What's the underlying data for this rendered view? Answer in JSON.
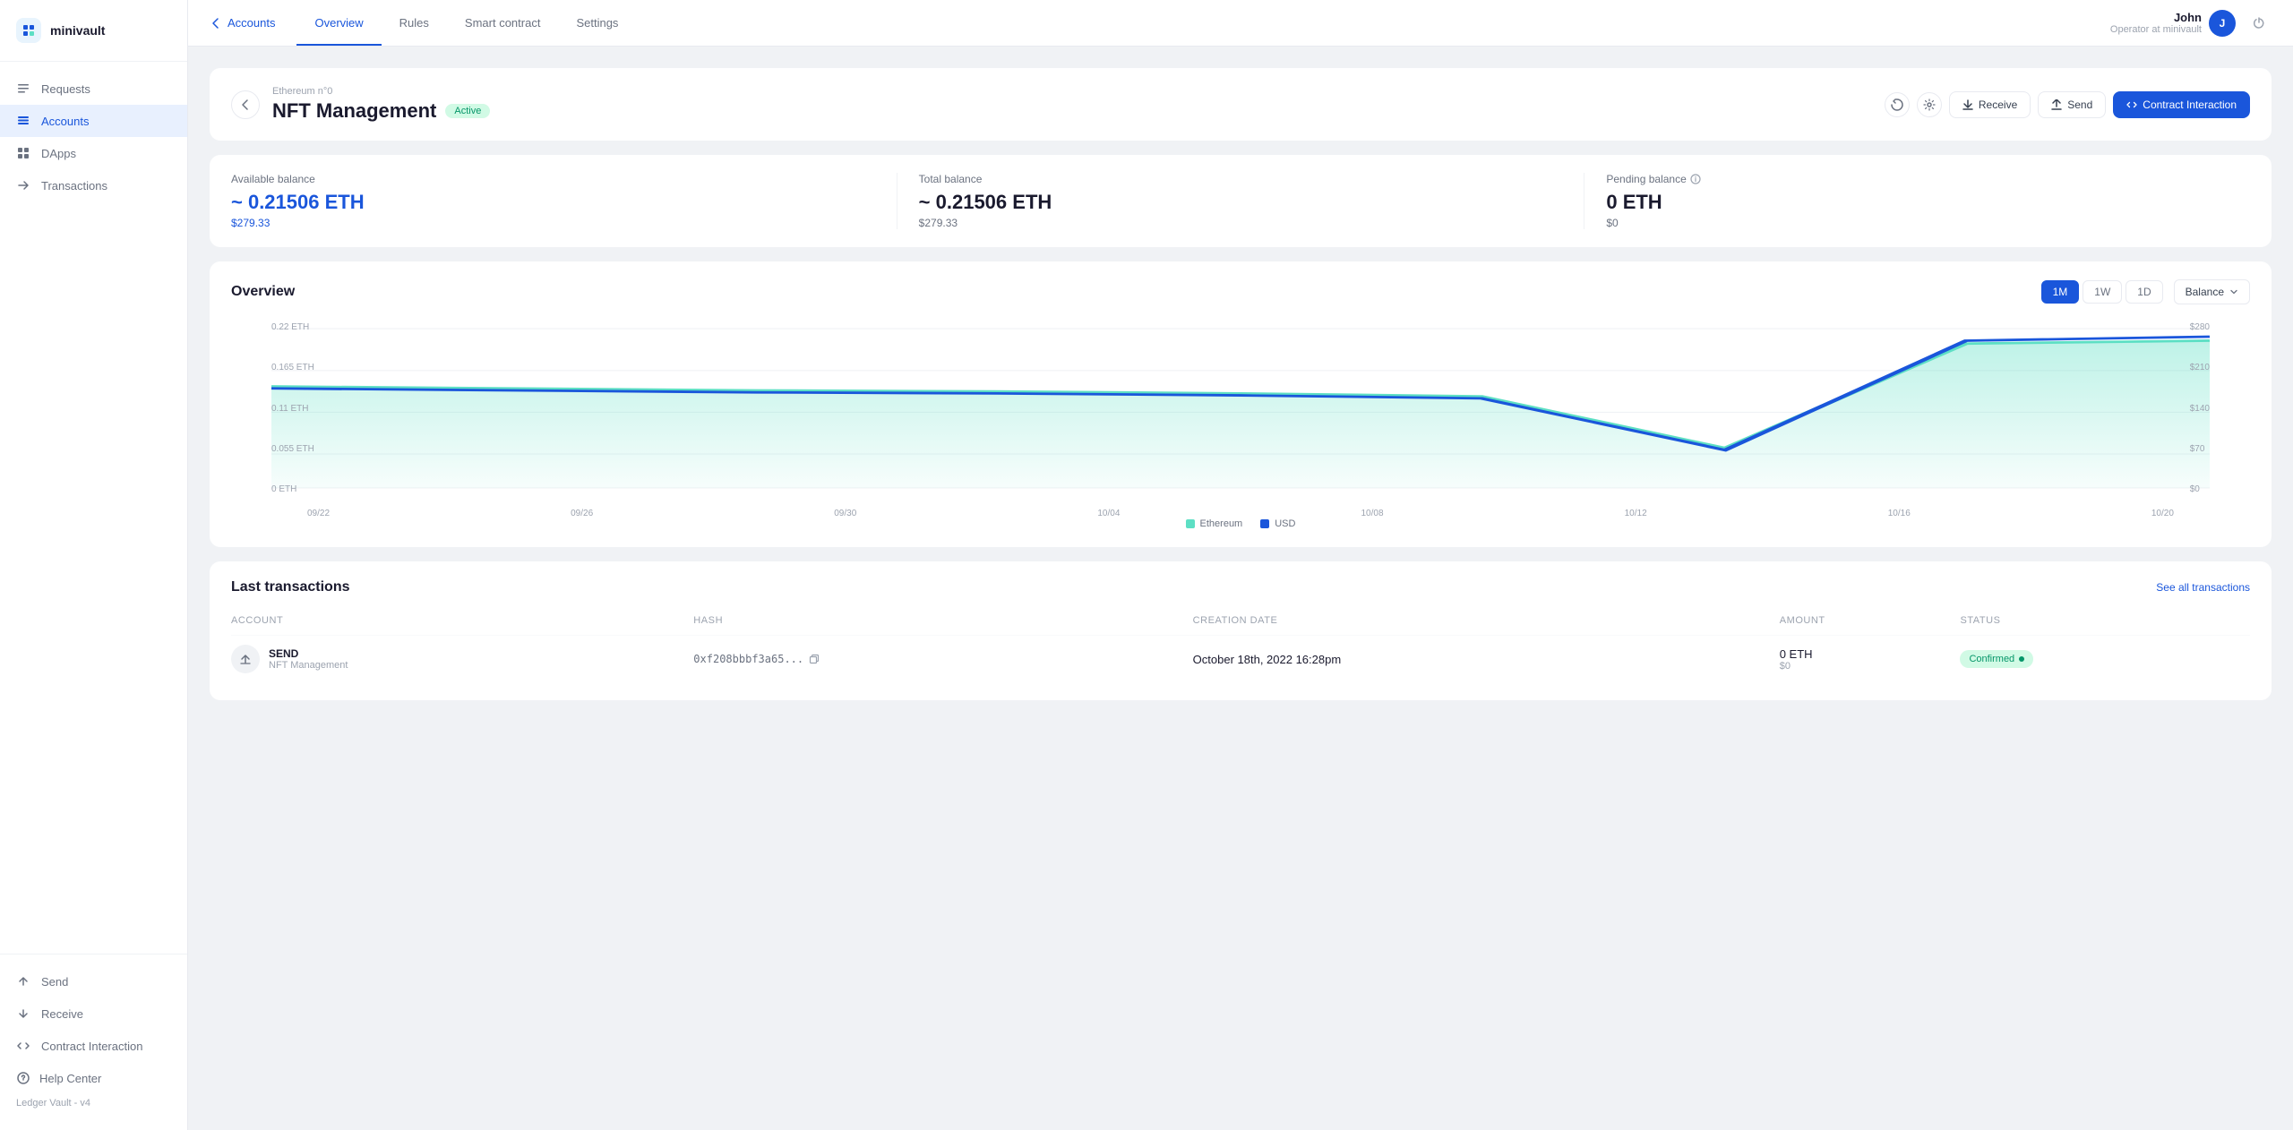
{
  "app": {
    "name": "minivault"
  },
  "sidebar": {
    "items": [
      {
        "id": "requests",
        "label": "Requests",
        "icon": "list"
      },
      {
        "id": "accounts",
        "label": "Accounts",
        "icon": "layers",
        "active": true
      },
      {
        "id": "dapps",
        "label": "DApps",
        "icon": "grid"
      },
      {
        "id": "transactions",
        "label": "Transactions",
        "icon": "arrow-right"
      }
    ],
    "bottom_items": [
      {
        "id": "send",
        "label": "Send",
        "icon": "arrow-up"
      },
      {
        "id": "receive",
        "label": "Receive",
        "icon": "arrow-down"
      },
      {
        "id": "contract",
        "label": "Contract Interaction",
        "icon": "code"
      }
    ],
    "help": "Help Center",
    "version": "Ledger Vault - v4"
  },
  "topnav": {
    "back_label": "Accounts",
    "tabs": [
      "Overview",
      "Rules",
      "Smart contract",
      "Settings"
    ],
    "active_tab": "Overview",
    "user": {
      "name": "John",
      "role": "Operator at minivault",
      "initial": "J"
    }
  },
  "account": {
    "sub_label": "Ethereum n°0",
    "name": "NFT Management",
    "status": "Active",
    "actions": {
      "refresh": "refresh",
      "settings": "settings",
      "receive": "Receive",
      "send": "Send",
      "contract": "Contract Interaction"
    }
  },
  "balances": {
    "available": {
      "label": "Available balance",
      "amount": "~ 0.21506 ETH",
      "usd": "$279.33"
    },
    "total": {
      "label": "Total balance",
      "amount": "~ 0.21506 ETH",
      "usd": "$279.33"
    },
    "pending": {
      "label": "Pending balance",
      "amount": "0 ETH",
      "usd": "$0",
      "info_icon": true
    }
  },
  "overview": {
    "title": "Overview",
    "periods": [
      "1M",
      "1W",
      "1D"
    ],
    "active_period": "1M",
    "view_select": "Balance",
    "chart": {
      "y_labels_left": [
        "0.22 ETH",
        "0.165 ETH",
        "0.11 ETH",
        "0.055 ETH",
        "0 ETH"
      ],
      "y_labels_right": [
        "$280",
        "$210",
        "$140",
        "$70",
        "$0"
      ],
      "x_labels": [
        "09/22",
        "09/26",
        "09/30",
        "10/04",
        "10/08",
        "10/12",
        "10/16",
        "10/20"
      ]
    },
    "legend": [
      {
        "label": "Ethereum",
        "color": "#5ddfc4"
      },
      {
        "label": "USD",
        "color": "#1a56db"
      }
    ]
  },
  "transactions": {
    "title": "Last transactions",
    "see_all": "See all transactions",
    "columns": [
      "ACCOUNT",
      "HASH",
      "CREATION DATE",
      "AMOUNT",
      "STATUS"
    ],
    "rows": [
      {
        "type": "SEND",
        "account": "NFT Management",
        "hash": "0xf208bbbf3a65...",
        "date": "October 18th, 2022 16:28pm",
        "amount": "0 ETH",
        "amount_usd": "$0",
        "status": "Confirmed",
        "status_type": "confirmed"
      }
    ]
  }
}
